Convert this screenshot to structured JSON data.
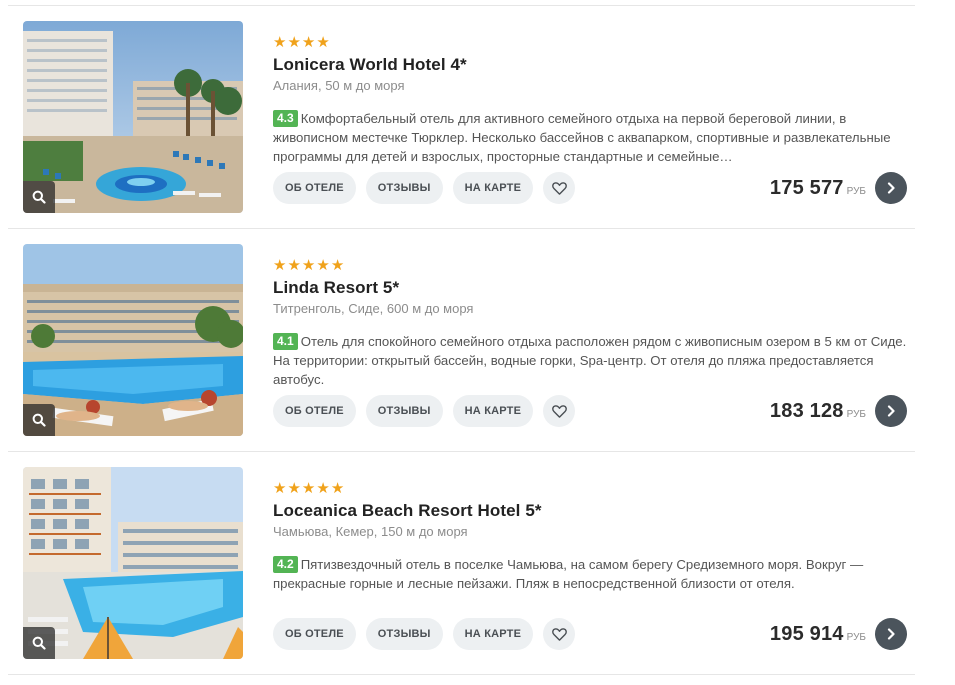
{
  "hotels": [
    {
      "stars": 4,
      "name": "Lonicera World Hotel 4*",
      "location": "Алания, 50 м до моря",
      "rating": "4.3",
      "description": "Комфортабельный отель для активного семейного отдыха на первой береговой линии, в живописном местечке Тюрклер. Несколько бассейнов с аквапарком, спортивные и развлекательные программы для детей и взрослых, просторные стандартные и семейные…",
      "price": "175 577",
      "currency": "РУБ"
    },
    {
      "stars": 5,
      "name": "Linda Resort 5*",
      "location": "Титренголь, Сиде, 600 м до моря",
      "rating": "4.1",
      "description": "Отель для спокойного семейного отдыха расположен рядом с живописным озером в 5 км от Сиде. На территории: открытый бассейн, водные горки, Spa-центр. От отеля до пляжа предоставляется автобус.",
      "price": "183 128",
      "currency": "РУБ"
    },
    {
      "stars": 5,
      "name": "Loceanica Beach Resort Hotel 5*",
      "location": "Чамьюва, Кемер, 150 м до моря",
      "rating": "4.2",
      "description": "Пятизвездочный отель в поселке Чамьюва, на самом берегу Средиземного моря. Вокруг — прекрасные горные и лесные пейзажи. Пляж в непосредственной близости от отеля.",
      "price": "195 914",
      "currency": "РУБ"
    }
  ],
  "buttons": {
    "about": "ОБ ОТЕЛЕ",
    "reviews": "ОТЗЫВЫ",
    "map": "НА КАРТЕ"
  },
  "icons": {
    "zoom": "magnifier-icon",
    "favorite": "heart-icon",
    "go": "chevron-right-icon",
    "star": "star-icon"
  },
  "colors": {
    "star": "#f0a21b",
    "rating_badge": "#53b454",
    "pill_bg": "#edf0f2",
    "go_button": "#4b545c"
  }
}
